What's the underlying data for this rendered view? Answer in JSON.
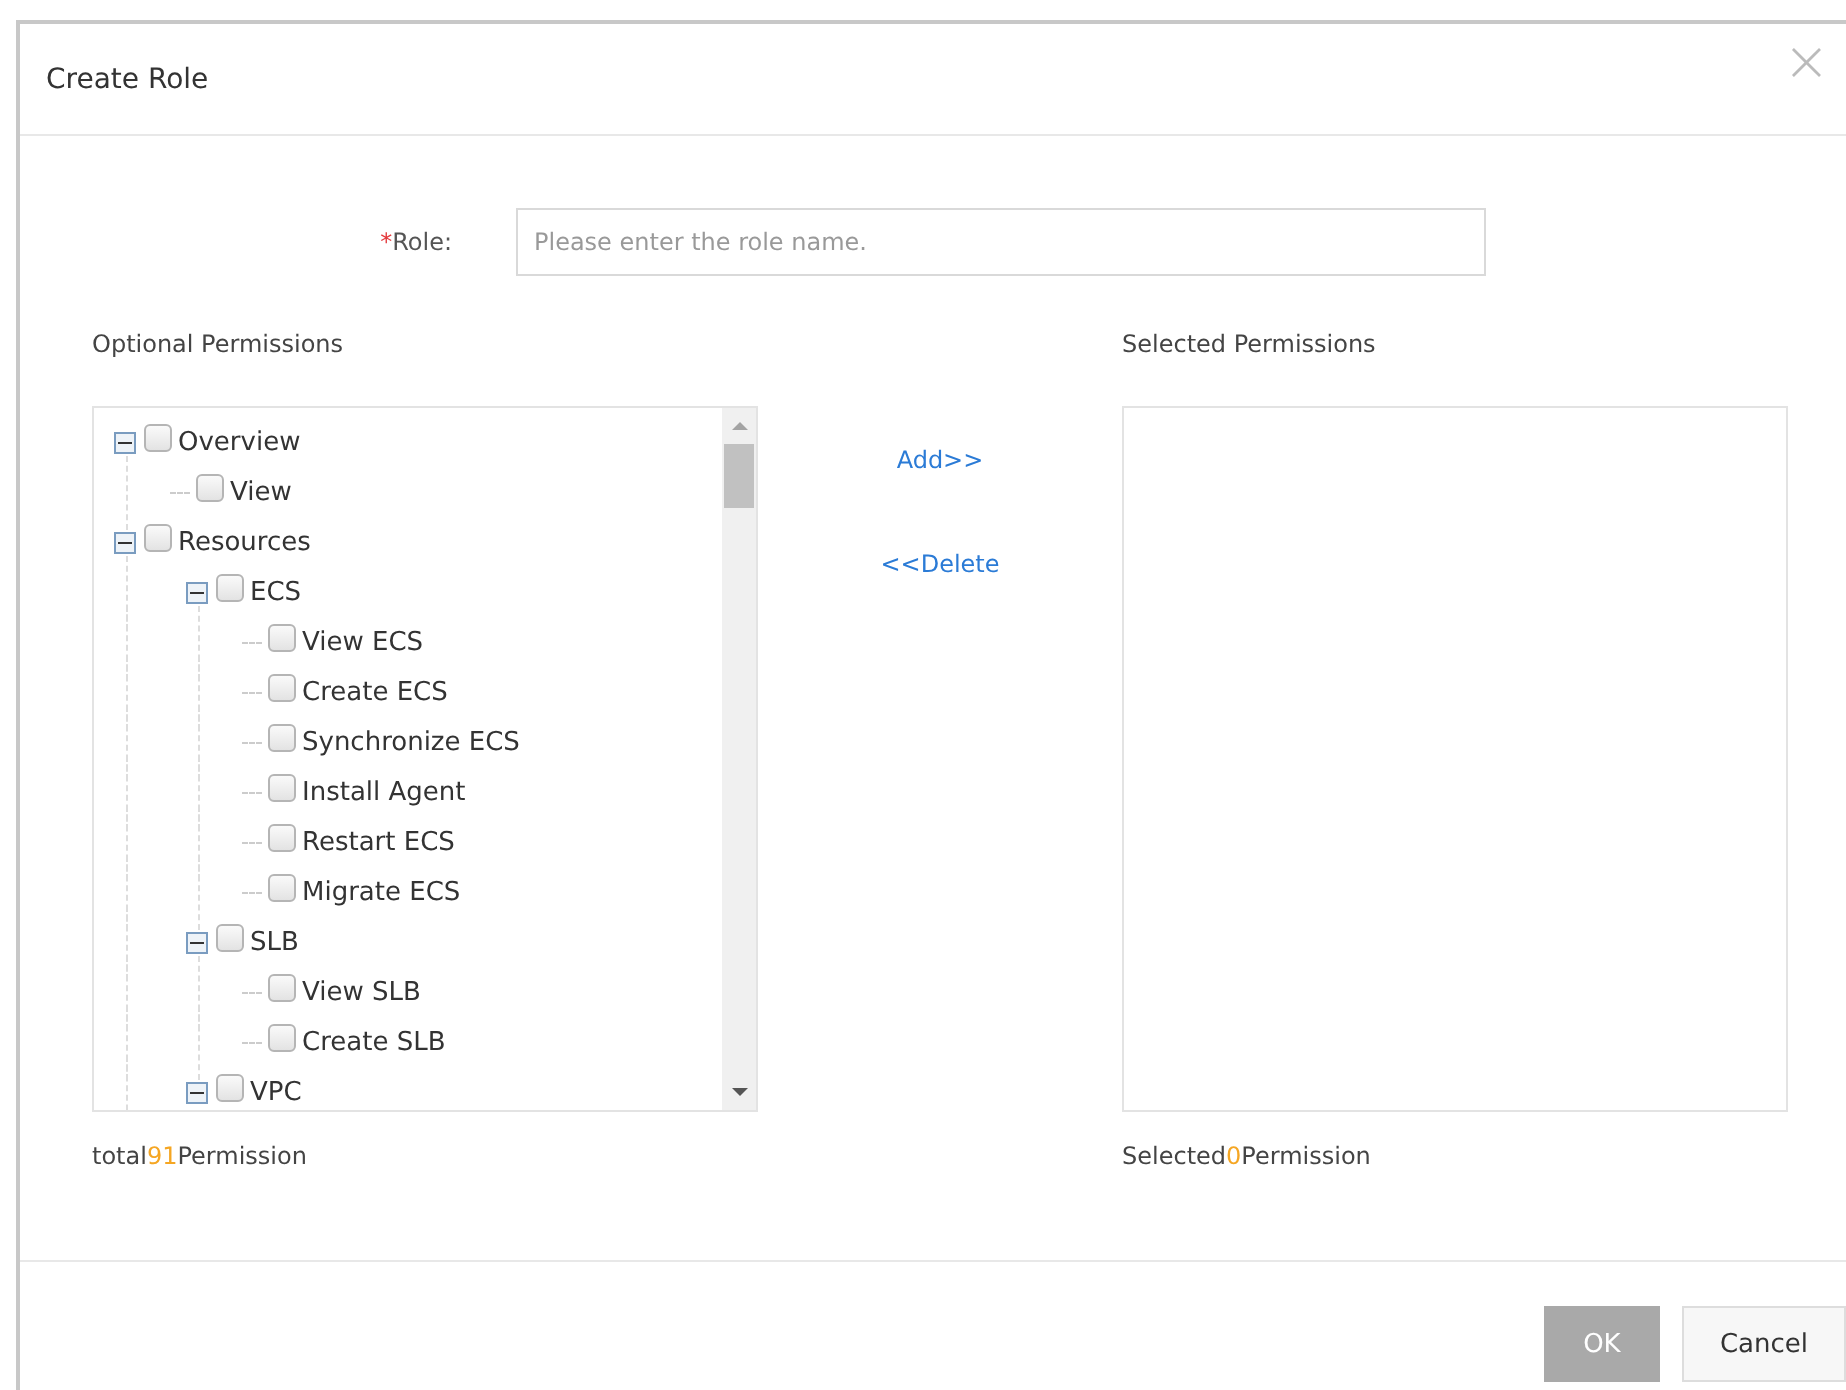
{
  "dialog": {
    "title": "Create Role",
    "close": "×"
  },
  "role_field": {
    "required_mark": "*",
    "label": "Role:",
    "placeholder": "Please enter the role name."
  },
  "optional": {
    "heading": "Optional Permissions",
    "tree": [
      {
        "label": "Overview",
        "checked": false,
        "expanded": true,
        "children": [
          {
            "label": "View",
            "checked": false
          }
        ]
      },
      {
        "label": "Resources",
        "checked": false,
        "expanded": true,
        "children": [
          {
            "label": "ECS",
            "checked": false,
            "expanded": true,
            "children": [
              {
                "label": "View ECS",
                "checked": false
              },
              {
                "label": "Create ECS",
                "checked": false
              },
              {
                "label": "Synchronize ECS",
                "checked": false
              },
              {
                "label": "Install Agent",
                "checked": false
              },
              {
                "label": "Restart ECS",
                "checked": false
              },
              {
                "label": "Migrate ECS",
                "checked": false
              }
            ]
          },
          {
            "label": "SLB",
            "checked": false,
            "expanded": true,
            "children": [
              {
                "label": "View SLB",
                "checked": false
              },
              {
                "label": "Create SLB",
                "checked": false
              }
            ]
          },
          {
            "label": "VPC",
            "checked": false,
            "expanded": true
          }
        ]
      }
    ],
    "count": {
      "prefix": "total",
      "number": "91",
      "suffix": "Permission"
    }
  },
  "actions": {
    "add": "Add>>",
    "delete": "<<Delete"
  },
  "selected": {
    "heading": "Selected Permissions",
    "count": {
      "prefix": "Selected",
      "number": "0",
      "suffix": "Permission"
    }
  },
  "footer": [
    {
      "label": "OK",
      "disabled": true
    },
    {
      "label": "Cancel",
      "disabled": false
    }
  ]
}
